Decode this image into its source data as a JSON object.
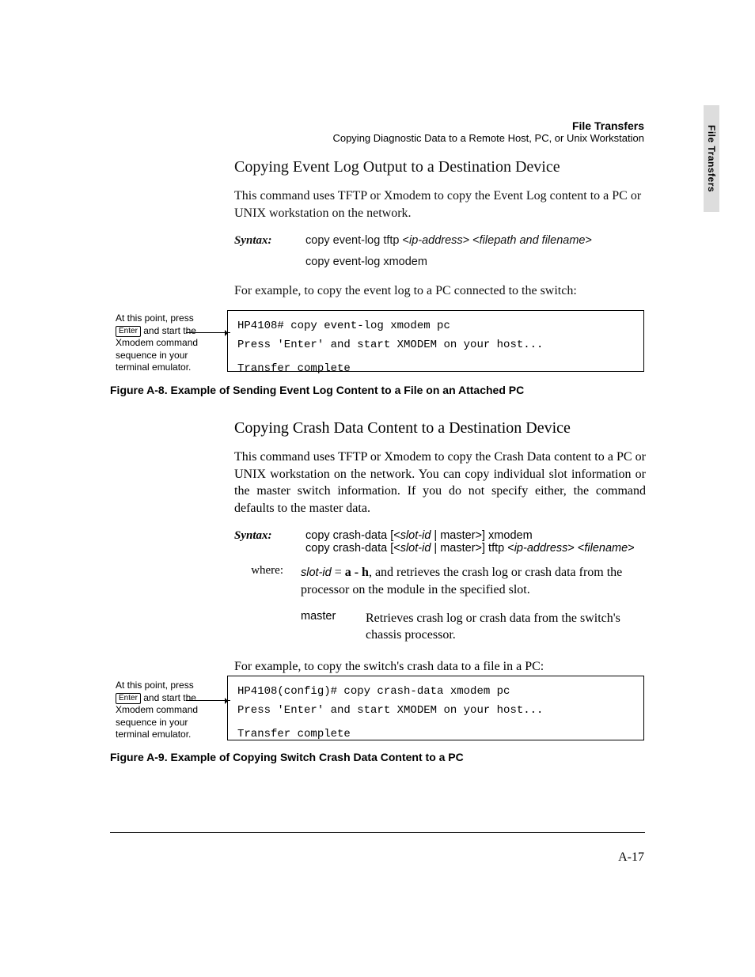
{
  "tab": {
    "label": "File Transfers"
  },
  "header": {
    "title": "File Transfers",
    "subtitle": "Copying Diagnostic Data to a Remote Host, PC, or Unix Workstation"
  },
  "section1": {
    "heading": "Copying Event Log Output to a Destination Device",
    "intro": "This command uses TFTP or Xmodem to copy the Event Log content to a PC or UNIX workstation on the network.",
    "syntax_label": "Syntax:",
    "syntax_line1_a": "copy event-log tftp <",
    "syntax_line1_b": "ip-address",
    "syntax_line1_c": "> <",
    "syntax_line1_d": "filepath and filename",
    "syntax_line1_e": ">",
    "syntax_line2": "copy event-log xmodem",
    "example_lead": "For example, to copy the event log to a PC connected to the switch:",
    "callout_a": "At this point, press",
    "callout_key": "Enter",
    "callout_b": " and start the Xmodem command sequence in your terminal emulator.",
    "term_l1": "HP4108# copy event-log xmodem pc",
    "term_l2": "Press 'Enter' and start XMODEM on your host...",
    "term_l3": "Transfer complete",
    "figure_caption": "Figure A-8.   Example of Sending Event Log Content to a File on an Attached PC"
  },
  "section2": {
    "heading": "Copying Crash Data Content to a Destination Device",
    "intro": "This command uses TFTP or Xmodem to copy the Crash Data content to a PC or UNIX workstation on the network.  You can copy individual slot information or the master switch information. If you do not specify either, the command defaults to the master data.",
    "syntax_label": "Syntax:",
    "syntax_line1_a": "copy crash-data [<",
    "syntax_line1_b": "slot-id",
    "syntax_line1_c": " | master>] xmodem",
    "syntax_line2_a": "copy crash-data [<",
    "syntax_line2_b": "slot-id",
    "syntax_line2_c": " | master>] tftp <",
    "syntax_line2_d": "ip-address",
    "syntax_line2_e": "> <",
    "syntax_line2_f": "filename",
    "syntax_line2_g": ">",
    "where_label": "where:",
    "where_term1": "slot-id",
    "where_eq": " = ",
    "where_bold": "a - h",
    "where_desc1": ", and  retrieves the crash log or crash data from the processor on the module in the specified slot.",
    "where_term2": "master",
    "where_desc2": "Retrieves crash log or crash data from the switch's chassis processor.",
    "example_lead": "For example, to copy the switch's crash data to a file in a PC:",
    "callout_a": "At this point, press",
    "callout_key": "Enter",
    "callout_b": " and start the Xmodem command sequence in your terminal emulator.",
    "term_l1": "HP4108(config)# copy crash-data xmodem pc",
    "term_l2": "Press 'Enter' and start XMODEM on your host...",
    "term_l3": "Transfer complete",
    "figure_caption": "Figure A-9.   Example of Copying Switch Crash Data Content to a PC"
  },
  "page_number": "A-17"
}
